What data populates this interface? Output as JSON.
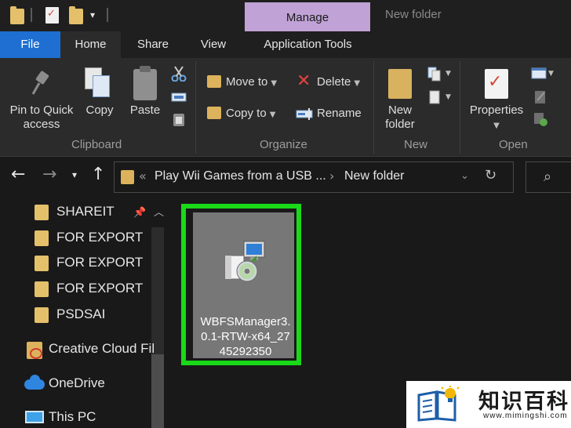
{
  "window": {
    "title": "New folder",
    "contextual_tab": "Manage"
  },
  "ribbon_tabs": [
    "File",
    "Home",
    "Share",
    "View",
    "Application Tools"
  ],
  "ribbon": {
    "clipboard": {
      "label": "Clipboard",
      "pin_label_1": "Pin to Quick",
      "pin_label_2": "access",
      "copy": "Copy",
      "paste": "Paste"
    },
    "organize": {
      "label": "Organize",
      "move_to": "Move to",
      "copy_to": "Copy to",
      "delete": "Delete",
      "rename": "Rename"
    },
    "new": {
      "label": "New",
      "new_folder_1": "New",
      "new_folder_2": "folder"
    },
    "open": {
      "label": "Open",
      "properties": "Properties"
    }
  },
  "address": {
    "segments": [
      "Play Wii Games from a USB ...",
      "New folder"
    ]
  },
  "nav_pane": {
    "quick_access": [
      "SHAREIT",
      "FOR EXPORT",
      "FOR EXPORT",
      "FOR EXPORT",
      "PSDSAI"
    ],
    "roots": [
      "Creative Cloud Fil",
      "OneDrive",
      "This PC"
    ]
  },
  "files": [
    {
      "name": "WBFSManager3.0.1-RTW-x64_2745292350",
      "selected": true
    }
  ],
  "watermark": {
    "cn": "知识百科",
    "url": "www.mimingshi.com"
  },
  "colors": {
    "accent_file_tab": "#1e6fd1",
    "manage_tab": "#c0a2d6",
    "highlight_border": "#19d919",
    "folder": "#e4c06a"
  }
}
